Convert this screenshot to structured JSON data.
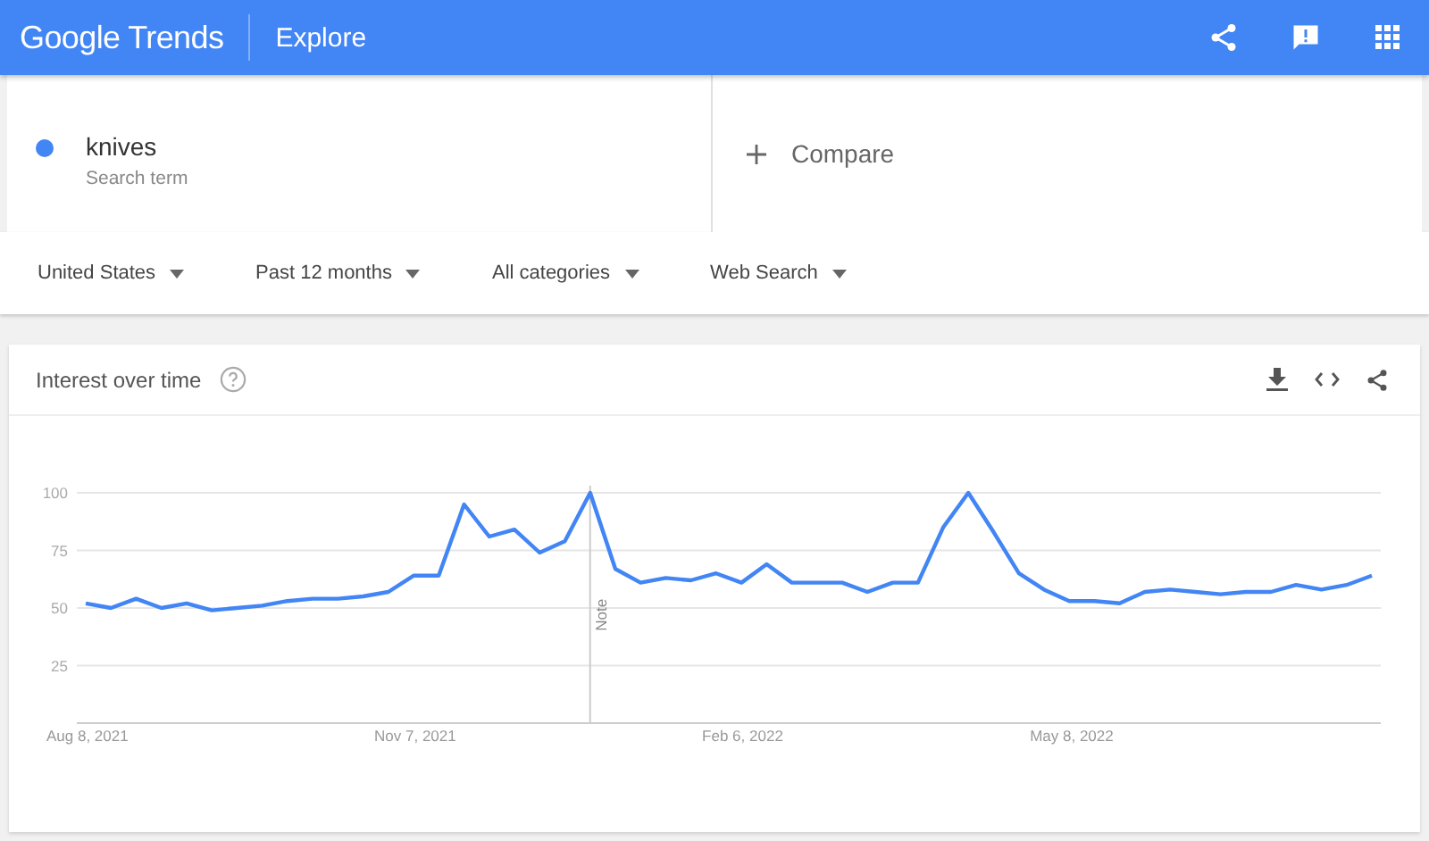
{
  "header": {
    "logo": "Google Trends",
    "title": "Explore"
  },
  "search": {
    "terms": [
      {
        "name": "knives",
        "sublabel": "Search term",
        "color": "#4285f4"
      }
    ],
    "compare": "Compare"
  },
  "filters": [
    "United States",
    "Past 12 months",
    "All categories",
    "Web Search"
  ],
  "card": {
    "title": "Interest over time",
    "chart_data": {
      "type": "line",
      "categories": [
        "Aug 8, 2021",
        null,
        null,
        null,
        null,
        null,
        null,
        null,
        null,
        null,
        null,
        null,
        null,
        "Nov 7, 2021",
        null,
        null,
        null,
        null,
        null,
        null,
        null,
        null,
        null,
        null,
        null,
        null,
        "Feb 6, 2022",
        null,
        null,
        null,
        null,
        null,
        null,
        null,
        null,
        null,
        null,
        null,
        null,
        "May 8, 2022",
        null,
        null,
        null,
        null,
        null,
        null,
        null,
        null,
        null,
        null,
        null,
        null
      ],
      "series": [
        {
          "color": "#4285f4",
          "values": [
            52,
            50,
            54,
            50,
            52,
            49,
            50,
            51,
            53,
            54,
            54,
            55,
            57,
            64,
            64,
            95,
            81,
            84,
            74,
            79,
            100,
            67,
            61,
            63,
            62,
            65,
            61,
            69,
            61,
            61,
            61,
            57,
            61,
            61,
            85,
            100,
            83,
            65,
            58,
            53,
            53,
            52,
            57,
            58,
            57,
            56,
            57,
            57,
            60,
            58,
            60,
            64
          ]
        }
      ],
      "ylim": [
        0,
        100
      ],
      "yticks": [
        25,
        50,
        75,
        100
      ],
      "grid": true,
      "annotations": [
        "Note"
      ]
    }
  }
}
